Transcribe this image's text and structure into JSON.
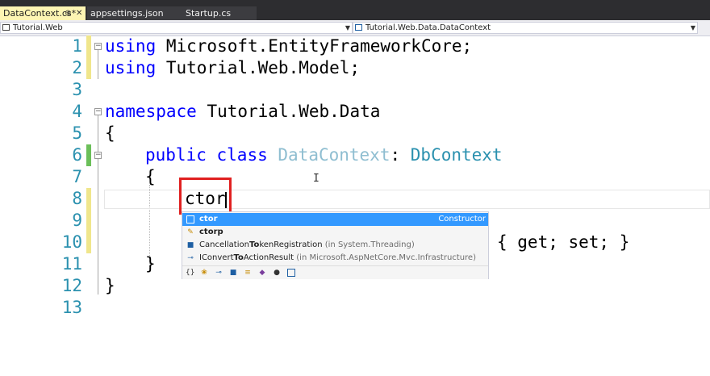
{
  "tabs": [
    {
      "label": "DataContext.cs*",
      "active": true
    },
    {
      "label": "appsettings.json",
      "active": false
    },
    {
      "label": "Startup.cs",
      "active": false
    }
  ],
  "navbar": {
    "project": "Tutorial.Web",
    "type": "Tutorial.Web.Data.DataContext"
  },
  "editor": {
    "line_numbers": [
      "1",
      "2",
      "3",
      "4",
      "5",
      "6",
      "7",
      "8",
      "9",
      "10",
      "11",
      "12",
      "13"
    ],
    "line1": {
      "kw": "using",
      "rest": " Microsoft.EntityFrameworkCore;"
    },
    "line2": {
      "kw": "using",
      "rest": " Tutorial.Web.Model;"
    },
    "line4": {
      "kw": "namespace",
      "rest": " Tutorial.Web.Data"
    },
    "line5": "{",
    "line6": {
      "kw1": "public",
      "kw2": "class",
      "class_name": "DataContext",
      "colon": ":",
      "base": "DbContext"
    },
    "line7": "{",
    "line8": "ctor",
    "line10_tail": "{ get; set; }",
    "line11": "}",
    "line12": "}"
  },
  "intellisense": {
    "items": [
      {
        "name": "ctor",
        "match": "ctor",
        "detail": "",
        "desc": "Constructor",
        "icon": "snippet-icon",
        "selected": true
      },
      {
        "name": "ctorp",
        "match": "ctor",
        "detail": "",
        "desc": "",
        "icon": "snippet-icon",
        "selected": false
      },
      {
        "pre": "Cancellation",
        "match": "To",
        "post": "kenRegistration",
        "detail": " (in System.Threading)",
        "icon": "struct-icon",
        "selected": false
      },
      {
        "pre": "IConvert",
        "match": "To",
        "post": "ActionResult",
        "detail": " (in Microsoft.AspNetCore.Mvc.Infrastructure)",
        "icon": "interface-icon",
        "selected": false
      }
    ],
    "filters": [
      "namespace-filter-icon",
      "class-filter-icon",
      "interface-filter-icon",
      "struct-filter-icon",
      "enum-filter-icon",
      "delegate-filter-icon",
      "extension-method-filter-icon",
      "snippet-filter-icon"
    ]
  },
  "colors": {
    "keyword": "#0000ff",
    "type": "#2b91af",
    "line_number": "#2b91af",
    "selection": "#3399ff",
    "highlight_box": "#e02020"
  }
}
